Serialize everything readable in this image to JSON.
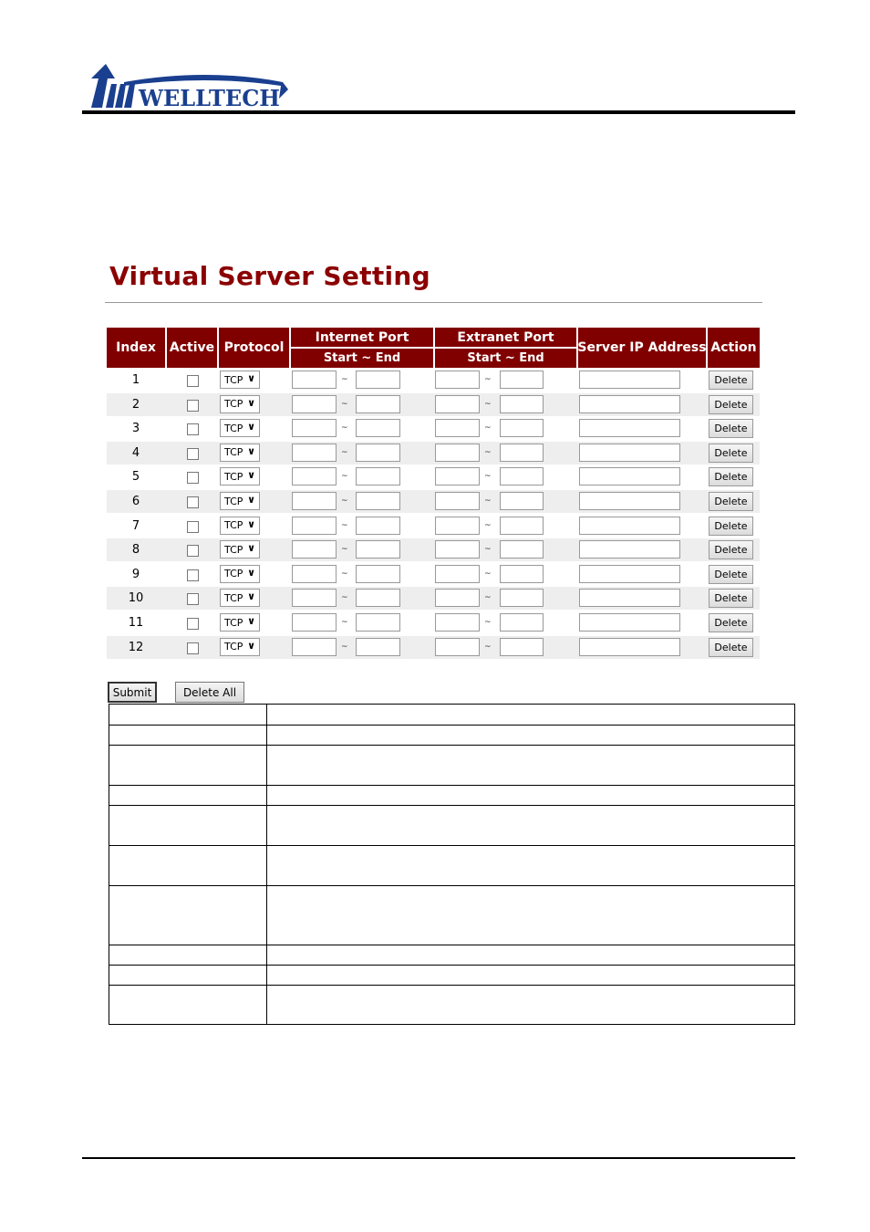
{
  "logo": {
    "text": "WELLTECH"
  },
  "title": "Virtual Server Setting",
  "colors": {
    "header": "#800000",
    "title": "#8b0000",
    "alt_row": "#eeeeee"
  },
  "table": {
    "headers": {
      "index": "Index",
      "active": "Active",
      "protocol": "Protocol",
      "internet_port": "Internet Port",
      "extranet_port": "Extranet Port",
      "start_end": "Start ~ End",
      "server_ip": "Server IP Address",
      "action": "Action"
    },
    "separator": "~",
    "delete_label": "Delete",
    "rows": [
      {
        "index": "1",
        "active": false,
        "protocol": "TCP"
      },
      {
        "index": "2",
        "active": false,
        "protocol": "TCP"
      },
      {
        "index": "3",
        "active": false,
        "protocol": "TCP"
      },
      {
        "index": "4",
        "active": false,
        "protocol": "TCP"
      },
      {
        "index": "5",
        "active": false,
        "protocol": "TCP"
      },
      {
        "index": "6",
        "active": false,
        "protocol": "TCP"
      },
      {
        "index": "7",
        "active": false,
        "protocol": "TCP"
      },
      {
        "index": "8",
        "active": false,
        "protocol": "TCP"
      },
      {
        "index": "9",
        "active": false,
        "protocol": "TCP"
      },
      {
        "index": "10",
        "active": false,
        "protocol": "TCP"
      },
      {
        "index": "11",
        "active": false,
        "protocol": "TCP"
      },
      {
        "index": "12",
        "active": false,
        "protocol": "TCP"
      }
    ]
  },
  "buttons": {
    "submit": "Submit",
    "delete_all": "Delete All"
  }
}
